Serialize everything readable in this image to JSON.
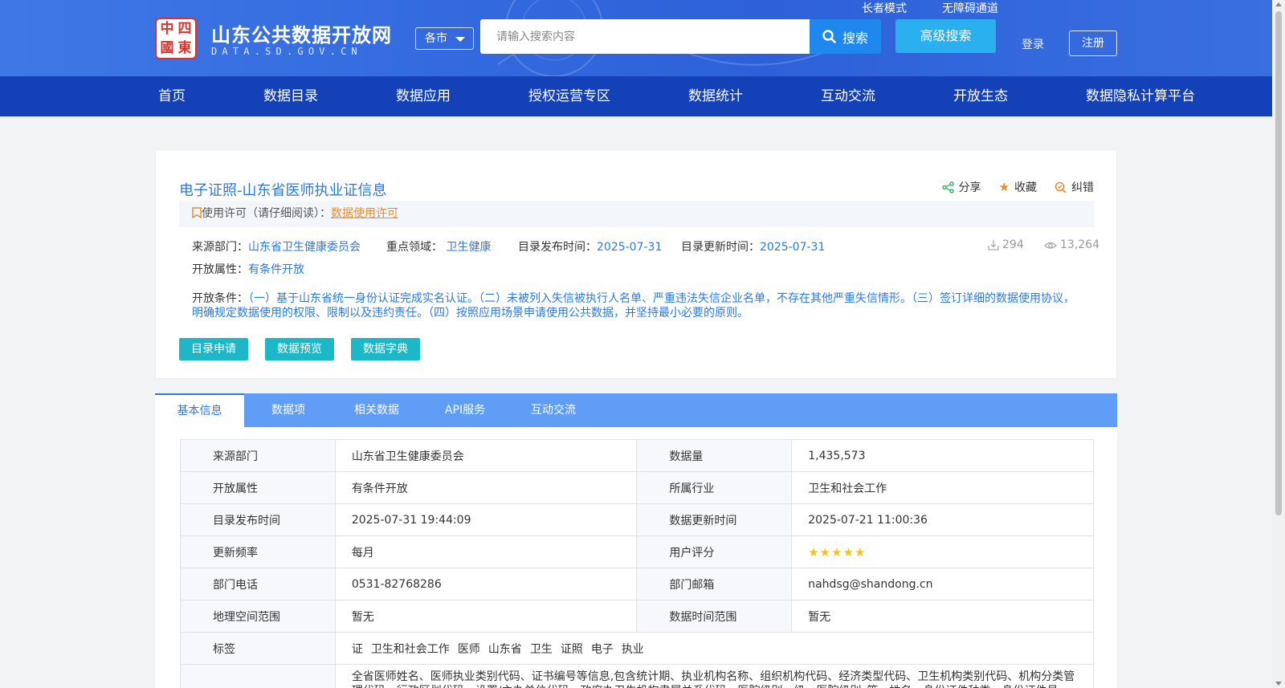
{
  "header": {
    "seal_chars": [
      "中",
      "四",
      "國",
      "東"
    ],
    "title": "山东公共数据开放网",
    "subtitle": "DATA.SD.GOV.CN",
    "region_select": "各市",
    "search": {
      "placeholder": "请输入搜索内容",
      "button_label": "搜索"
    },
    "advanced_search_label": "高级搜索",
    "elder_mode_label": "长者模式",
    "accessibility_label": "无障碍通道",
    "login_label": "登录",
    "register_label": "注册"
  },
  "nav": {
    "items": [
      "首页",
      "数据目录",
      "数据应用",
      "授权运营专区",
      "数据统计",
      "互动交流",
      "开放生态",
      "数据隐私计算平台"
    ]
  },
  "dataset": {
    "title": "电子证照-山东省医师执业证信息",
    "actions": {
      "share": "分享",
      "favorite": "收藏",
      "correct": "纠错"
    },
    "license_prefix": "使用许可（请仔细阅读）：",
    "license_link": "数据使用许可",
    "source_label": "来源部门：",
    "source_value": "山东省卫生健康委员会",
    "domain_label": "重点领域：",
    "domain_value": "卫生健康",
    "publish_label": "目录发布时间：",
    "publish_value": "2025-07-31",
    "update_label": "目录更新时间：",
    "update_value": "2025-07-31",
    "downloads": "294",
    "views": "13,264",
    "open_attr_label": "开放属性：",
    "open_attr_value": "有条件开放",
    "condition_label": "开放条件：",
    "condition_value": "（一）基于山东省统一身份认证完成实名认证。（二）未被列入失信被执行人名单、严重违法失信企业名单，不存在其他严重失信情形。（三）签订详细的数据使用协议，明确规定数据使用的权限、限制以及违约责任。（四）按照应用场景申请使用公共数据，并坚持最小必要的原则。",
    "buttons": {
      "apply": "目录申请",
      "preview": "数据预览",
      "dictionary": "数据字典"
    }
  },
  "tabs": [
    "基本信息",
    "数据项",
    "相关数据",
    "API服务",
    "互动交流"
  ],
  "info": {
    "rows": [
      [
        "来源部门",
        "山东省卫生健康委员会",
        "数据量",
        "1,435,573"
      ],
      [
        "开放属性",
        "有条件开放",
        "所属行业",
        "卫生和社会工作"
      ],
      [
        "目录发布时间",
        "2025-07-31 19:44:09",
        "数据更新时间",
        "2025-07-21 11:00:36"
      ],
      [
        "更新频率",
        "每月",
        "用户评分",
        "★★★★★"
      ],
      [
        "部门电话",
        "0531-82768286",
        "部门邮箱",
        "nahdsg@shandong.cn"
      ],
      [
        "地理空间范围",
        "暂无",
        "数据时间范围",
        "暂无"
      ]
    ],
    "tags_label": "标签",
    "tags": [
      "证",
      "卫生和社会工作",
      "医师",
      "山东省",
      "卫生",
      "证照",
      "电子",
      "执业"
    ],
    "description": "全省医师姓名、医师执业类别代码、证书编号等信息,包含统计期、执业机构名称、组织机构代码、经济类型代码、卫生机构类别代码、机构分类管理代码、行政区划代码、设置/主办单位代码、政府办卫生机构隶属关系代码、医院级别、级、医院级别_等、姓名、身份证件种类、身份证件号码、出生"
  },
  "colors": {
    "header_blue": "#2d60d9",
    "nav_blue": "#1440b8",
    "link_blue": "#2a7ae2",
    "teal_button": "#1cb8c8",
    "tab_bar": "#5f9df7",
    "license_orange": "#f08a24",
    "star_yellow": "#f7c31a"
  }
}
